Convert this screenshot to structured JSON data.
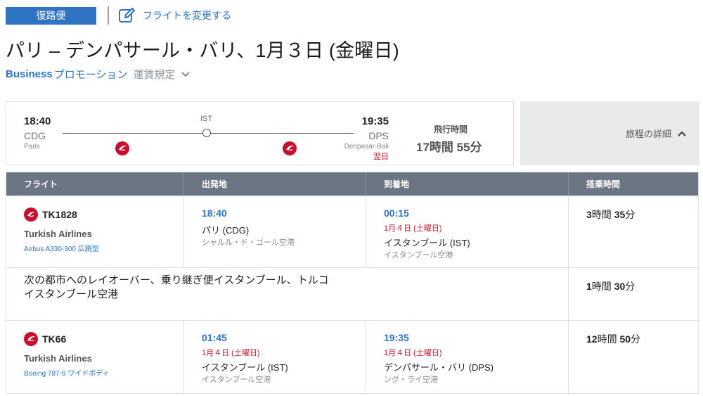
{
  "header": {
    "return_badge": "復路便",
    "change_flight": "フライトを変更する",
    "route_title": "パリ – デンパサール・バリ、1月３日 (金曜日)"
  },
  "fare": {
    "class": "Business",
    "promo": "プロモーション",
    "rules": "運賃規定"
  },
  "summary": {
    "dep_time": "18:40",
    "dep_code": "CDG",
    "dep_city": "Paris",
    "stop_code": "IST",
    "arr_time": "19:35",
    "arr_code": "DPS",
    "arr_city": "Denpasar-Bali",
    "arr_next_day": "翌日",
    "duration_label": "飛行時間",
    "duration_value": "17時間 55分",
    "details_label": "旅程の詳細"
  },
  "table": {
    "headers": [
      "フライト",
      "出発地",
      "到着地",
      "搭乗時間"
    ],
    "segments": [
      {
        "flight_no": "TK1828",
        "airline": "Turkish Airlines",
        "aircraft": "Airbus A330-300 広胴型",
        "dep_time": "18:40",
        "dep_place": "パリ (CDG)",
        "dep_airport": "シャルル・ド・ゴール空港",
        "arr_time": "00:15",
        "arr_date": "1月４日 (土曜日)",
        "arr_place": "イスタンブール (IST)",
        "arr_airport": "イスタンブール空港",
        "duration_h": "3",
        "duration_h_unit": "時間",
        "duration_m": "35",
        "duration_m_unit": "分"
      },
      {
        "flight_no": "TK66",
        "airline": "Turkish Airlines",
        "aircraft": "Boeing 787-9 ワイドボディ",
        "dep_time": "01:45",
        "dep_date": "1月４日 (土曜日)",
        "dep_place": "イスタンブール (IST)",
        "dep_airport": "イスタンブール空港",
        "arr_time": "19:35",
        "arr_date": "1月４日 (土曜日)",
        "arr_place": "デンパサール・バリ (DPS)",
        "arr_airport": "ング・ライ空港",
        "duration_h": "12",
        "duration_h_unit": "時間",
        "duration_m": "50",
        "duration_m_unit": "分"
      }
    ],
    "layover": {
      "line1": "次の都市へのレイオーバー、乗り継ぎ便イスタンブール、トルコ",
      "line2": "イスタンブール空港",
      "duration_h": "1",
      "duration_h_unit": "時間",
      "duration_m": "30",
      "duration_m_unit": "分"
    }
  },
  "colors": {
    "accent": "#2f73c5",
    "header_bg": "#6b7583",
    "alert_red": "#c8102e",
    "airline_logo": "#c8102e"
  },
  "icons": [
    "edit-icon",
    "chevron-down-icon",
    "chevron-up-icon",
    "turkish-airlines-logo"
  ]
}
